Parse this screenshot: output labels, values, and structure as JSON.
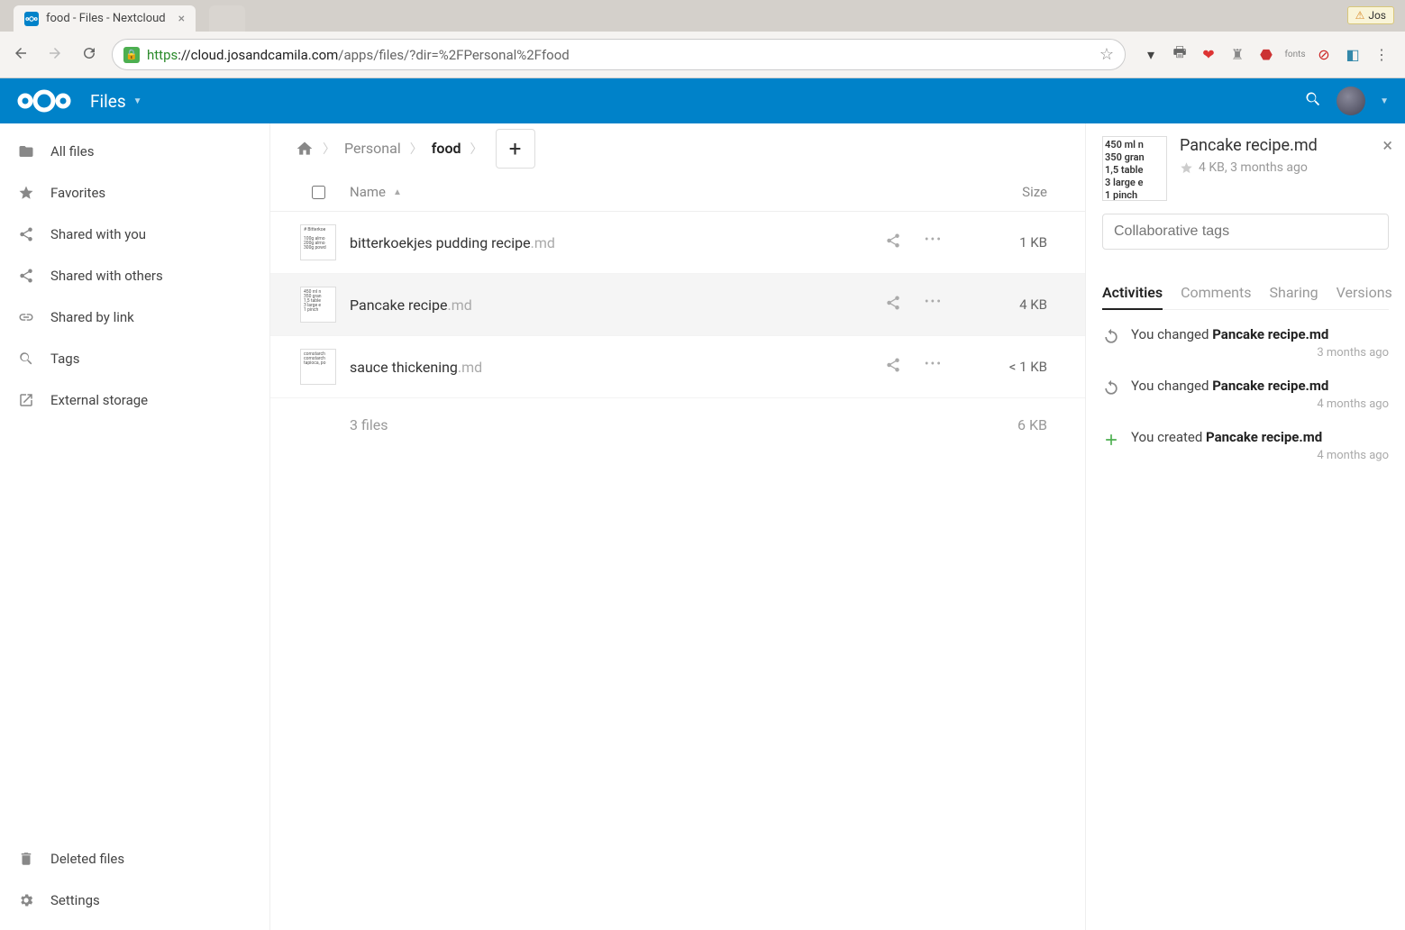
{
  "browser": {
    "tab_title": "food - Files - Nextcloud",
    "user_badge": "Jos",
    "url_https": "https",
    "url_domain": "://cloud.josandcamila.com",
    "url_path": "/apps/files/?dir=%2FPersonal%2Ffood"
  },
  "header": {
    "app_name": "Files"
  },
  "sidebar": {
    "items": [
      {
        "label": "All files"
      },
      {
        "label": "Favorites"
      },
      {
        "label": "Shared with you"
      },
      {
        "label": "Shared with others"
      },
      {
        "label": "Shared by link"
      },
      {
        "label": "Tags"
      },
      {
        "label": "External storage"
      }
    ],
    "bottom": [
      {
        "label": "Deleted files"
      },
      {
        "label": "Settings"
      }
    ]
  },
  "breadcrumbs": {
    "items": [
      {
        "label": "Personal"
      },
      {
        "label": "food"
      }
    ]
  },
  "filelist": {
    "header_name": "Name",
    "header_size": "Size",
    "rows": [
      {
        "name": "bitterkoekjes pudding recipe",
        "ext": ".md",
        "size": "1 KB",
        "thumb": "# Bitterkoe\n\n100g almo\n200g almo\n300g powd",
        "selected": false
      },
      {
        "name": "Pancake recipe",
        "ext": ".md",
        "size": "4 KB",
        "thumb": "450 ml n\n350 gran\n1,5 table\n3 large e\n1 pinch",
        "selected": true
      },
      {
        "name": "sauce thickening",
        "ext": ".md",
        "size": "< 1 KB",
        "thumb": "cornstarch\ncornstarch\ntapioca, po",
        "selected": false
      }
    ],
    "summary_files": "3 files",
    "summary_size": "6 KB"
  },
  "details": {
    "thumb_text": "450 ml n\n350 gran\n1,5 table\n3 large e\n1 pinch",
    "title": "Pancake recipe.md",
    "meta": "4 KB, 3 months ago",
    "tags_placeholder": "Collaborative tags",
    "tabs": [
      {
        "label": "Activities",
        "active": true
      },
      {
        "label": "Comments",
        "active": false
      },
      {
        "label": "Sharing",
        "active": false
      },
      {
        "label": "Versions",
        "active": false
      }
    ],
    "activities": [
      {
        "icon": "change",
        "text_prefix": "You changed ",
        "text_bold": "Pancake recipe.md",
        "time": "3 months ago"
      },
      {
        "icon": "change",
        "text_prefix": "You changed ",
        "text_bold": "Pancake recipe.md",
        "time": "4 months ago"
      },
      {
        "icon": "create",
        "text_prefix": "You created ",
        "text_bold": "Pancake recipe.md",
        "time": "4 months ago"
      }
    ]
  }
}
